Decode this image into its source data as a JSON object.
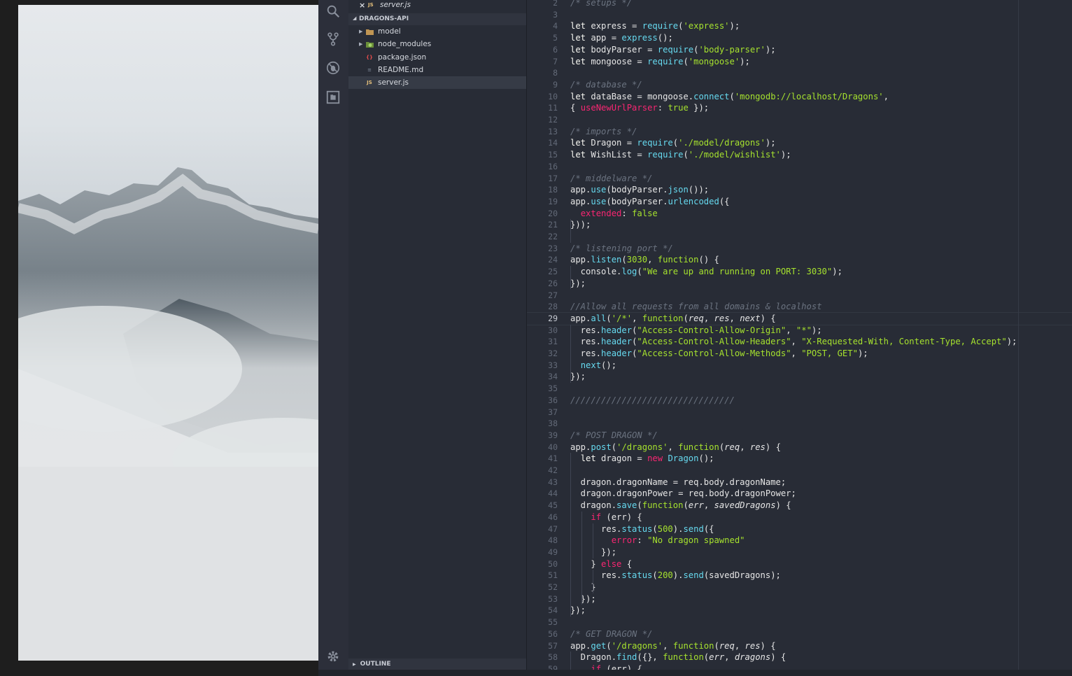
{
  "open_editors": {
    "file_icon": "JS",
    "file_name": "server.js"
  },
  "explorer": {
    "project": "DRAGONS-API",
    "items": [
      {
        "name": "model",
        "kind": "folder",
        "icon_color": "#c09553"
      },
      {
        "name": "node_modules",
        "kind": "folder",
        "icon_color": "#8bc34a"
      },
      {
        "name": "package.json",
        "kind": "file",
        "badge": "{}",
        "icon_color": "#e44c4c"
      },
      {
        "name": "README.md",
        "kind": "file",
        "badge": "≡",
        "icon_color": "#6e7787"
      },
      {
        "name": "server.js",
        "kind": "file",
        "badge": "JS",
        "icon_color": "#e5c07b",
        "active": true
      }
    ],
    "outline_label": "OUTLINE"
  },
  "editor": {
    "first_line_number": 2,
    "current_line": 29,
    "lines": [
      [
        [
          "/* setups */",
          "com"
        ]
      ],
      [],
      [
        [
          "let ",
          "kw"
        ],
        [
          "express = ",
          ""
        ],
        [
          "require",
          "fn"
        ],
        [
          "(",
          ""
        ],
        [
          "'express'",
          "str"
        ],
        [
          ");",
          ""
        ]
      ],
      [
        [
          "let ",
          "kw"
        ],
        [
          "app = ",
          ""
        ],
        [
          "express",
          "fn"
        ],
        [
          "();",
          ""
        ]
      ],
      [
        [
          "let ",
          "kw"
        ],
        [
          "bodyParser = ",
          ""
        ],
        [
          "require",
          "fn"
        ],
        [
          "(",
          ""
        ],
        [
          "'body-parser'",
          "str"
        ],
        [
          ");",
          ""
        ]
      ],
      [
        [
          "let ",
          "kw"
        ],
        [
          "mongoose = ",
          ""
        ],
        [
          "require",
          "fn"
        ],
        [
          "(",
          ""
        ],
        [
          "'mongoose'",
          "str"
        ],
        [
          ");",
          ""
        ]
      ],
      [],
      [
        [
          "/* database */",
          "com"
        ]
      ],
      [
        [
          "let ",
          "kw"
        ],
        [
          "dataBase = mongoose.",
          ""
        ],
        [
          "connect",
          "fn"
        ],
        [
          "(",
          ""
        ],
        [
          "'mongodb://localhost/Dragons'",
          "str"
        ],
        [
          ",",
          ""
        ]
      ],
      [
        [
          "{ ",
          ""
        ],
        [
          "useNewUrlParser",
          "red"
        ],
        [
          ": ",
          ""
        ],
        [
          "true",
          "str"
        ],
        [
          " });",
          ""
        ]
      ],
      [],
      [
        [
          "/* imports */",
          "com"
        ]
      ],
      [
        [
          "let ",
          "kw"
        ],
        [
          "Dragon = ",
          ""
        ],
        [
          "require",
          "fn"
        ],
        [
          "(",
          ""
        ],
        [
          "'./model/dragons'",
          "str"
        ],
        [
          ");",
          ""
        ]
      ],
      [
        [
          "let ",
          "kw"
        ],
        [
          "WishList = ",
          ""
        ],
        [
          "require",
          "fn"
        ],
        [
          "(",
          ""
        ],
        [
          "'./model/wishlist'",
          "str"
        ],
        [
          ");",
          ""
        ]
      ],
      [],
      [
        [
          "/* middelware */",
          "com"
        ]
      ],
      [
        [
          "app.",
          ""
        ],
        [
          "use",
          "fn"
        ],
        [
          "(bodyParser.",
          ""
        ],
        [
          "json",
          "fn"
        ],
        [
          "());",
          ""
        ]
      ],
      [
        [
          "app.",
          ""
        ],
        [
          "use",
          "fn"
        ],
        [
          "(bodyParser.",
          ""
        ],
        [
          "urlencoded",
          "fn"
        ],
        [
          "({",
          ""
        ]
      ],
      [
        [
          "  ",
          ""
        ],
        [
          "extended",
          "red"
        ],
        [
          ": ",
          ""
        ],
        [
          "false",
          "str"
        ]
      ],
      [
        [
          "}));",
          ""
        ]
      ],
      [],
      [
        [
          "/* listening port */",
          "com"
        ]
      ],
      [
        [
          "app.",
          ""
        ],
        [
          "listen",
          "fn"
        ],
        [
          "(",
          ""
        ],
        [
          "3030",
          "str"
        ],
        [
          ", ",
          ""
        ],
        [
          "function",
          "str"
        ],
        [
          "() {",
          ""
        ]
      ],
      [
        [
          "  console.",
          ""
        ],
        [
          "log",
          "fn"
        ],
        [
          "(",
          ""
        ],
        [
          "\"We are up and running on PORT: 3030\"",
          "str"
        ],
        [
          ");",
          ""
        ]
      ],
      [
        [
          "});",
          ""
        ]
      ],
      [],
      [
        [
          "//Allow all requests from all domains & localhost",
          "com"
        ]
      ],
      [
        [
          "app.",
          ""
        ],
        [
          "all",
          "fn"
        ],
        [
          "(",
          ""
        ],
        [
          "'/*'",
          "str"
        ],
        [
          ", ",
          ""
        ],
        [
          "function",
          "str"
        ],
        [
          "(",
          ""
        ],
        [
          "req",
          "ital"
        ],
        [
          ", ",
          ""
        ],
        [
          "res",
          "ital"
        ],
        [
          ", ",
          ""
        ],
        [
          "next",
          "ital"
        ],
        [
          ") {",
          ""
        ]
      ],
      [
        [
          "  res.",
          ""
        ],
        [
          "header",
          "fn"
        ],
        [
          "(",
          ""
        ],
        [
          "\"Access-Control-Allow-Origin\"",
          "str"
        ],
        [
          ", ",
          ""
        ],
        [
          "\"*\"",
          "str"
        ],
        [
          ");",
          ""
        ]
      ],
      [
        [
          "  res.",
          ""
        ],
        [
          "header",
          "fn"
        ],
        [
          "(",
          ""
        ],
        [
          "\"Access-Control-Allow-Headers\"",
          "str"
        ],
        [
          ", ",
          ""
        ],
        [
          "\"X-Requested-With, Content-Type, Accept\"",
          "str"
        ],
        [
          ");",
          ""
        ]
      ],
      [
        [
          "  res.",
          ""
        ],
        [
          "header",
          "fn"
        ],
        [
          "(",
          ""
        ],
        [
          "\"Access-Control-Allow-Methods\"",
          "str"
        ],
        [
          ", ",
          ""
        ],
        [
          "\"POST, GET\"",
          "str"
        ],
        [
          ");",
          ""
        ]
      ],
      [
        [
          "  ",
          ""
        ],
        [
          "next",
          "fn"
        ],
        [
          "();",
          ""
        ]
      ],
      [
        [
          "});",
          ""
        ]
      ],
      [],
      [
        [
          "////////////////////////////////",
          "com"
        ]
      ],
      [],
      [],
      [
        [
          "/* POST DRAGON */",
          "com"
        ]
      ],
      [
        [
          "app.",
          ""
        ],
        [
          "post",
          "fn"
        ],
        [
          "(",
          ""
        ],
        [
          "'/dragons'",
          "str"
        ],
        [
          ", ",
          ""
        ],
        [
          "function",
          "str"
        ],
        [
          "(",
          ""
        ],
        [
          "req",
          "ital"
        ],
        [
          ", ",
          ""
        ],
        [
          "res",
          "ital"
        ],
        [
          ") {",
          ""
        ]
      ],
      [
        [
          "  ",
          ""
        ],
        [
          "let ",
          "kw"
        ],
        [
          "dragon = ",
          ""
        ],
        [
          "new ",
          "red"
        ],
        [
          "Dragon",
          "fn"
        ],
        [
          "();",
          ""
        ]
      ],
      [],
      [
        [
          "  dragon.dragonName = req.body.dragonName;",
          ""
        ]
      ],
      [
        [
          "  dragon.dragonPower = req.body.dragonPower;",
          ""
        ]
      ],
      [
        [
          "  dragon.",
          ""
        ],
        [
          "save",
          "fn"
        ],
        [
          "(",
          ""
        ],
        [
          "function",
          "str"
        ],
        [
          "(",
          ""
        ],
        [
          "err",
          "ital"
        ],
        [
          ", ",
          ""
        ],
        [
          "savedDragons",
          "ital"
        ],
        [
          ") {",
          ""
        ]
      ],
      [
        [
          "    ",
          ""
        ],
        [
          "if ",
          "red"
        ],
        [
          "(err) {",
          ""
        ]
      ],
      [
        [
          "      res.",
          ""
        ],
        [
          "status",
          "fn"
        ],
        [
          "(",
          ""
        ],
        [
          "500",
          "str"
        ],
        [
          ").",
          ""
        ],
        [
          "send",
          "fn"
        ],
        [
          "({",
          ""
        ]
      ],
      [
        [
          "        ",
          ""
        ],
        [
          "error",
          "red"
        ],
        [
          ": ",
          ""
        ],
        [
          "\"No dragon spawned\"",
          "str"
        ]
      ],
      [
        [
          "      });",
          ""
        ]
      ],
      [
        [
          "    } ",
          ""
        ],
        [
          "else ",
          "red"
        ],
        [
          "{",
          ""
        ]
      ],
      [
        [
          "      res.",
          ""
        ],
        [
          "status",
          "fn"
        ],
        [
          "(",
          ""
        ],
        [
          "200",
          "str"
        ],
        [
          ").",
          ""
        ],
        [
          "send",
          "fn"
        ],
        [
          "(savedDragons);",
          ""
        ]
      ],
      [
        [
          "    }",
          ""
        ]
      ],
      [
        [
          "  });",
          ""
        ]
      ],
      [
        [
          "});",
          ""
        ]
      ],
      [],
      [
        [
          "/* GET DRAGON */",
          "com"
        ]
      ],
      [
        [
          "app.",
          ""
        ],
        [
          "get",
          "fn"
        ],
        [
          "(",
          ""
        ],
        [
          "'/dragons'",
          "str"
        ],
        [
          ", ",
          ""
        ],
        [
          "function",
          "str"
        ],
        [
          "(",
          ""
        ],
        [
          "req",
          "ital"
        ],
        [
          ", ",
          ""
        ],
        [
          "res",
          "ital"
        ],
        [
          ") {",
          ""
        ]
      ],
      [
        [
          "  Dragon.",
          ""
        ],
        [
          "find",
          "fn"
        ],
        [
          "({}, ",
          ""
        ],
        [
          "function",
          "str"
        ],
        [
          "(",
          ""
        ],
        [
          "err",
          "ital"
        ],
        [
          ", ",
          ""
        ],
        [
          "dragons",
          "ital"
        ],
        [
          ") {",
          ""
        ]
      ],
      [
        [
          "    ",
          ""
        ],
        [
          "if ",
          "red"
        ],
        [
          "(err) {",
          ""
        ]
      ]
    ]
  }
}
